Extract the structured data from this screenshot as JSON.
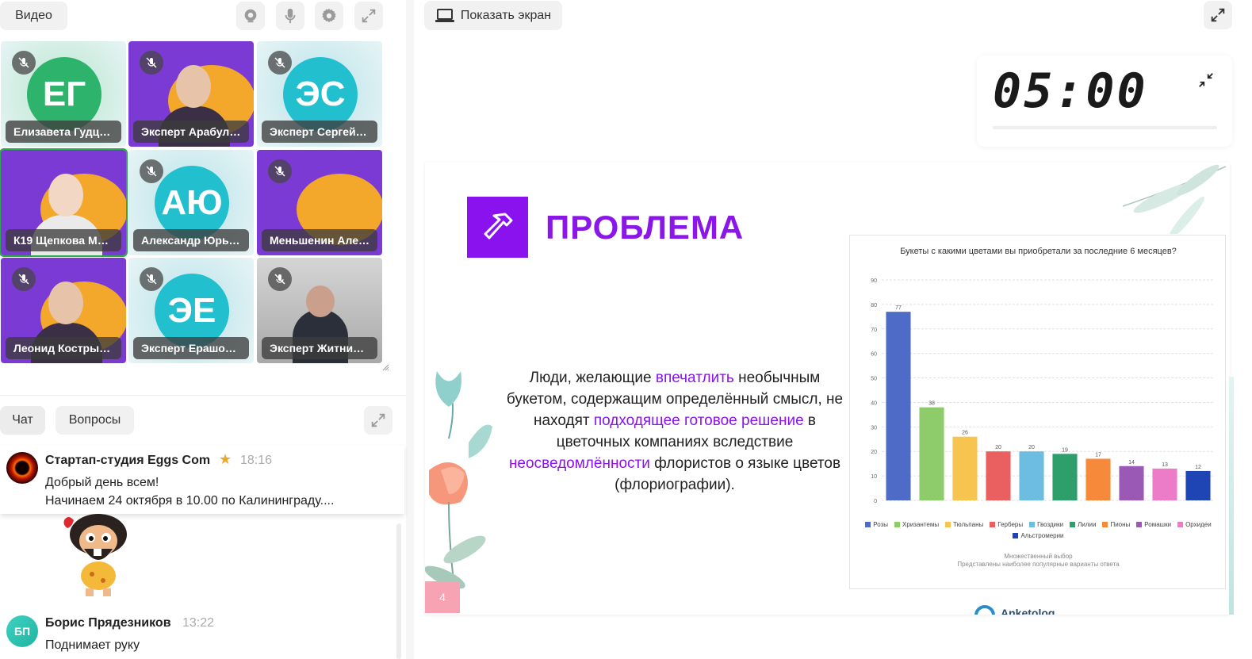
{
  "video_panel": {
    "label": "Видео",
    "icons": [
      "webcam-icon",
      "microphone-icon",
      "gear-icon",
      "expand-icon"
    ]
  },
  "participants": [
    {
      "name": "Елизавета Гудц…",
      "initials": "ЕГ",
      "color": "#2db36b",
      "type": "avatar",
      "bg": "#b9e6cd",
      "muted": true
    },
    {
      "name": "Эксперт Арабул…",
      "initials": "",
      "type": "video-purple",
      "muted": true
    },
    {
      "name": "Эксперт Сергей …",
      "initials": "ЭС",
      "color": "#22bfcf",
      "type": "avatar",
      "bg": "#b9e3ea",
      "muted": true
    },
    {
      "name": "К19 Щепкова Ма…",
      "initials": "",
      "type": "video-purple",
      "muted": false,
      "active": true
    },
    {
      "name": "Александр Юрь…",
      "initials": "АЮ",
      "color": "#22bfcf",
      "type": "avatar",
      "bg": "#b9e3ea",
      "muted": true
    },
    {
      "name": "Меньшенин Але…",
      "initials": "",
      "type": "video-purple",
      "muted": true
    },
    {
      "name": "Леонид Костры…",
      "initials": "",
      "type": "video-purple",
      "muted": true
    },
    {
      "name": "Эксперт Ерашов…",
      "initials": "ЭЕ",
      "color": "#22bfcf",
      "type": "avatar",
      "bg": "#b9e3ea",
      "muted": true
    },
    {
      "name": "Эксперт Житни…",
      "initials": "",
      "type": "video-gray",
      "muted": true
    }
  ],
  "chat": {
    "tabs": [
      "Чат",
      "Вопросы"
    ],
    "pinned": {
      "author": "Стартап-студия Eggs Com",
      "time": "18:16",
      "lines": [
        "Добрый день всем!",
        "Начинаем 24 октября в 10.00 по Калининграду...."
      ]
    },
    "message": {
      "initials": "БП",
      "author": "Борис Прядезников",
      "time": "13:22",
      "text": "Поднимает руку"
    }
  },
  "screen_share": {
    "button_label": "Показать экран"
  },
  "timer": {
    "value": "05:00"
  },
  "slide": {
    "title": "ПРОБЛЕМА",
    "paragraph": [
      {
        "t": "Люди, желающие ",
        "hl": false
      },
      {
        "t": "впечатлить",
        "hl": true
      },
      {
        "t": " необычным букетом, содержащим определённый смысл, не находят ",
        "hl": false
      },
      {
        "t": "подходящее готовое решение",
        "hl": true
      },
      {
        "t": " в цветочных компаниях вследствие ",
        "hl": false
      },
      {
        "t": "неосведомлённости",
        "hl": true
      },
      {
        "t": " флористов о языке цветов (флориографии).",
        "hl": false
      }
    ],
    "page_number": "4",
    "footer_logo_text": "Anketolog"
  },
  "chart_data": {
    "type": "bar",
    "title": "Букеты с какими цветами вы приобретали за последние 6 месяцев?",
    "categories": [
      "Розы",
      "Хризантемы",
      "Тюльпаны",
      "Герберы",
      "Гвоздики",
      "Лилии",
      "Пионы",
      "Ромашки",
      "Орхидеи",
      "Альстромерии"
    ],
    "values": [
      77,
      38,
      26,
      20,
      20,
      19,
      17,
      14,
      13,
      12
    ],
    "colors": [
      "#4f6bc8",
      "#8ecb6a",
      "#f6c44f",
      "#ea5f5f",
      "#6dbde0",
      "#2e9e6b",
      "#f7893b",
      "#9b59b6",
      "#ec7cc7",
      "#1f45b5"
    ],
    "ylim": [
      0,
      90
    ],
    "yticks": [
      0,
      10,
      20,
      30,
      40,
      50,
      60,
      70,
      80,
      90
    ],
    "grid": true,
    "legend_position": "bottom",
    "notes": [
      "Множественный выбор",
      "Представлены наиболее популярные варианты ответа"
    ]
  }
}
